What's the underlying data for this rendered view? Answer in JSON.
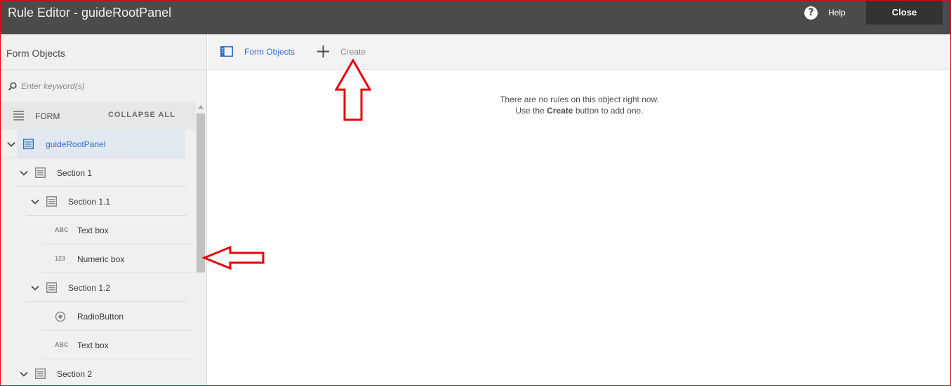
{
  "header": {
    "title": "Rule Editor - guideRootPanel",
    "help_label": "Help",
    "close_label": "Close"
  },
  "sidebar": {
    "title": "Form Objects",
    "search_placeholder": "Enter keyword(s)",
    "form_label": "FORM",
    "collapse_all_label": "COLLAPSE ALL",
    "tree": [
      {
        "label": "guideRootPanel",
        "icon": "panel-icon",
        "depth": 0,
        "expandable": true,
        "selected": true
      },
      {
        "label": "Section 1",
        "icon": "panel-icon",
        "depth": 1,
        "expandable": true
      },
      {
        "label": "Section 1.1",
        "icon": "panel-icon",
        "depth": 2,
        "expandable": true
      },
      {
        "label": "Text box",
        "icon": "textbox-icon",
        "tag": "ABC",
        "depth": 3
      },
      {
        "label": "Numeric box",
        "icon": "numericbox-icon",
        "tag": "123",
        "depth": 3
      },
      {
        "label": "Section 1.2",
        "icon": "panel-icon",
        "depth": 2,
        "expandable": true
      },
      {
        "label": "RadioButton",
        "icon": "radio-icon",
        "depth": 3
      },
      {
        "label": "Text box",
        "icon": "textbox-icon",
        "tag": "ABC",
        "depth": 3
      },
      {
        "label": "Section 2",
        "icon": "panel-icon",
        "depth": 1,
        "expandable": true
      }
    ]
  },
  "toolbar": {
    "form_objects_label": "Form Objects",
    "create_label": "Create"
  },
  "empty_state": {
    "line1": "There are no rules on this object right now.",
    "line2_pre": "Use the ",
    "line2_bold": "Create",
    "line2_post": " button to add one."
  },
  "colors": {
    "header_bg": "#4b4b4b",
    "accent_blue": "#326ec8",
    "annotation_red": "#e8000a"
  }
}
